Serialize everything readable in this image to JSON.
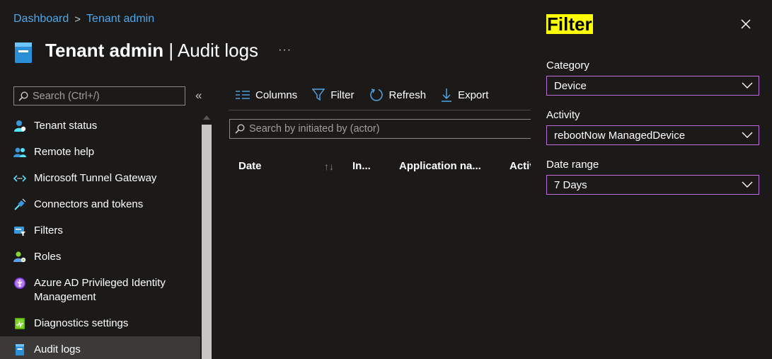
{
  "breadcrumb": {
    "items": [
      "Dashboard",
      "Tenant admin"
    ],
    "separator": ">"
  },
  "header": {
    "title_bold": "Tenant admin",
    "title_separator": " | ",
    "title_light": "Audit logs",
    "more": "···"
  },
  "sidebar": {
    "search_placeholder": "Search (Ctrl+/)",
    "collapse": "«",
    "items": [
      {
        "label": "Tenant status",
        "icon": "person-icon"
      },
      {
        "label": "Remote help",
        "icon": "people-icon"
      },
      {
        "label": "Microsoft Tunnel Gateway",
        "icon": "tunnel-icon"
      },
      {
        "label": "Connectors and tokens",
        "icon": "plug-icon"
      },
      {
        "label": "Filters",
        "icon": "filter-card-icon"
      },
      {
        "label": "Roles",
        "icon": "roles-icon"
      },
      {
        "label": "Azure AD Privileged Identity Management",
        "icon": "pim-icon"
      },
      {
        "label": "Diagnostics settings",
        "icon": "diagnostics-icon"
      },
      {
        "label": "Audit logs",
        "icon": "audit-log-icon",
        "active": true
      }
    ]
  },
  "toolbar": {
    "columns": "Columns",
    "filter": "Filter",
    "refresh": "Refresh",
    "export": "Export"
  },
  "actor_search": {
    "placeholder": "Search by initiated by (actor)"
  },
  "table": {
    "columns": [
      "Date",
      "In...",
      "Application na...",
      "Activi"
    ],
    "sort_glyph": "↑↓"
  },
  "filter_panel": {
    "title": "Filter",
    "fields": [
      {
        "label": "Category",
        "value": "Device"
      },
      {
        "label": "Activity",
        "value": "rebootNow ManagedDevice"
      },
      {
        "label": "Date range",
        "value": "7 Days"
      }
    ]
  },
  "colors": {
    "accent": "#4fa6e8",
    "dropdown_border": "#c16bd6",
    "highlight": "#ffff00",
    "background": "#1b1a19"
  }
}
